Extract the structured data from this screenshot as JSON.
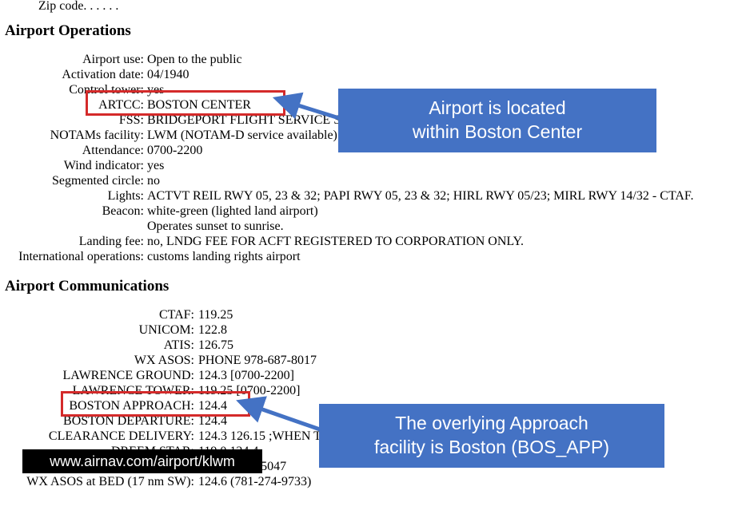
{
  "fragments": {
    "zip_partial": "Zip code. . . . . ."
  },
  "headings": {
    "operations": "Airport Operations",
    "communications": "Airport Communications"
  },
  "ops": {
    "rows": [
      {
        "label": "Airport use:",
        "value": "Open to the public"
      },
      {
        "label": "Activation date:",
        "value": "04/1940"
      },
      {
        "label": "Control tower:",
        "value": "yes"
      },
      {
        "label": "ARTCC:",
        "value": "BOSTON CENTER"
      },
      {
        "label": "FSS:",
        "value": "BRIDGEPORT FLIGHT SERVICE STATION"
      },
      {
        "label": "NOTAMs facility:",
        "value": "LWM (NOTAM-D service available)"
      },
      {
        "label": "Attendance:",
        "value": "0700-2200"
      },
      {
        "label": "Wind indicator:",
        "value": "yes"
      },
      {
        "label": "Segmented circle:",
        "value": "no"
      },
      {
        "label": "Lights:",
        "value": "ACTVT REIL RWY 05, 23 & 32; PAPI RWY 05, 23 & 32; HIRL RWY 05/23; MIRL RWY 14/32 - CTAF."
      },
      {
        "label": "Beacon:",
        "value": "white-green (lighted land airport)"
      },
      {
        "label": "",
        "value": "Operates sunset to sunrise."
      },
      {
        "label": "Landing fee:",
        "value": "no, LNDG FEE FOR ACFT REGISTERED TO CORPORATION ONLY."
      },
      {
        "label": "International operations:",
        "value": "customs landing rights airport"
      }
    ]
  },
  "comms": {
    "rows": [
      {
        "label": "CTAF:",
        "value": "119.25"
      },
      {
        "label": "UNICOM:",
        "value": "122.8"
      },
      {
        "label": "ATIS:",
        "value": "126.75"
      },
      {
        "label": "WX ASOS:",
        "value": "PHONE 978-687-8017"
      },
      {
        "label": "LAWRENCE GROUND:",
        "value": "124.3 [0700-2200]"
      },
      {
        "label": "LAWRENCE TOWER:",
        "value": "119.25 [0700-2200]"
      },
      {
        "label": "BOSTON APPROACH:",
        "value": "124.4"
      },
      {
        "label": "BOSTON DEPARTURE:",
        "value": "124.4"
      },
      {
        "label": "CLEARANCE DELIVERY:",
        "value": "124.3 126.15 ;WHEN TWR CLSD."
      },
      {
        "label": "DREEM STAR:",
        "value": "119.0 124.4"
      },
      {
        "label": "",
        "value": "118-921-5047"
      },
      {
        "label": "WX ASOS at BED (17 nm SW):",
        "value": "124.6 (781-274-9733)"
      }
    ]
  },
  "callouts": {
    "c1_line1": "Airport is located",
    "c1_line2": "within Boston Center",
    "c2_line1": "The overlying Approach",
    "c2_line2": "facility is Boston (BOS_APP)"
  },
  "banner": {
    "text": "www.airnav.com/airport/klwm"
  }
}
